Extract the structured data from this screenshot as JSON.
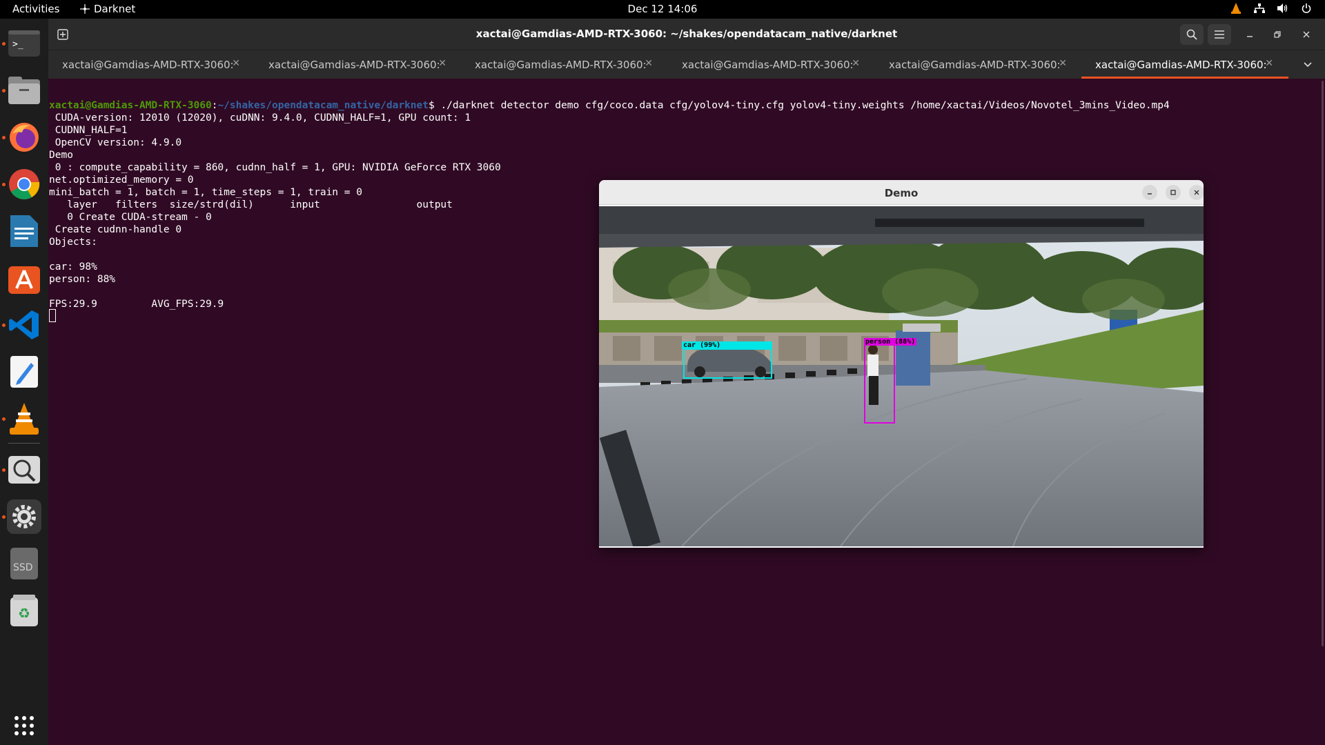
{
  "topbar": {
    "activities": "Activities",
    "app_name": "Darknet",
    "clock": "Dec 12  14:06"
  },
  "dock": {
    "items": [
      "terminal-icon",
      "files-icon",
      "firefox-icon",
      "chrome-icon",
      "libreoffice-writer-icon",
      "app-center-icon",
      "vscode-icon",
      "text-editor-icon",
      "vlc-icon",
      "image-viewer-icon",
      "settings-icon",
      "ssd-drive-icon",
      "trash-icon",
      "show-apps-icon"
    ],
    "ssd_label": "SSD"
  },
  "terminal": {
    "title": "xactai@Gamdias-AMD-RTX-3060: ~/shakes/opendatacam_native/darknet",
    "tabs": [
      {
        "label": "xactai@Gamdias-AMD-RTX-3060: ..."
      },
      {
        "label": "xactai@Gamdias-AMD-RTX-3060: ..."
      },
      {
        "label": "xactai@Gamdias-AMD-RTX-3060: ..."
      },
      {
        "label": "xactai@Gamdias-AMD-RTX-3060: ..."
      },
      {
        "label": "xactai@Gamdias-AMD-RTX-3060: ..."
      },
      {
        "label": "xactai@Gamdias-AMD-RTX-3060: ..."
      }
    ],
    "prompt_user": "xactai@Gamdias-AMD-RTX-3060",
    "prompt_sep": ":",
    "prompt_path": "~/shakes/opendatacam_native/darknet",
    "command": "$ ./darknet detector demo cfg/coco.data cfg/yolov4-tiny.cfg yolov4-tiny.weights /home/xactai/Videos/Novotel_3mins_Video.mp4",
    "output": [
      " CUDA-version: 12010 (12020), cuDNN: 9.4.0, CUDNN_HALF=1, GPU count: 1",
      " CUDNN_HALF=1",
      " OpenCV version: 4.9.0",
      "Demo",
      " 0 : compute_capability = 860, cudnn_half = 1, GPU: NVIDIA GeForce RTX 3060",
      "net.optimized_memory = 0",
      "mini_batch = 1, batch = 1, time_steps = 1, train = 0",
      "   layer   filters  size/strd(dil)      input                output",
      "   0 Create CUDA-stream - 0",
      " Create cudnn-handle 0",
      "Objects:",
      "",
      "car: 98%",
      "person: 88%",
      "",
      "FPS:29.9         AVG_FPS:29.9"
    ]
  },
  "demo_window": {
    "title": "Demo",
    "detections": [
      {
        "label": "car (99%)",
        "class": "car",
        "color": "#00e5e5"
      },
      {
        "label": "person (88%)",
        "class": "person",
        "color": "#e000e0"
      }
    ]
  },
  "colors": {
    "terminal_bg": "#300a24",
    "accent": "#e95420",
    "prompt_user": "#4e9a06",
    "prompt_path": "#3465a4"
  }
}
